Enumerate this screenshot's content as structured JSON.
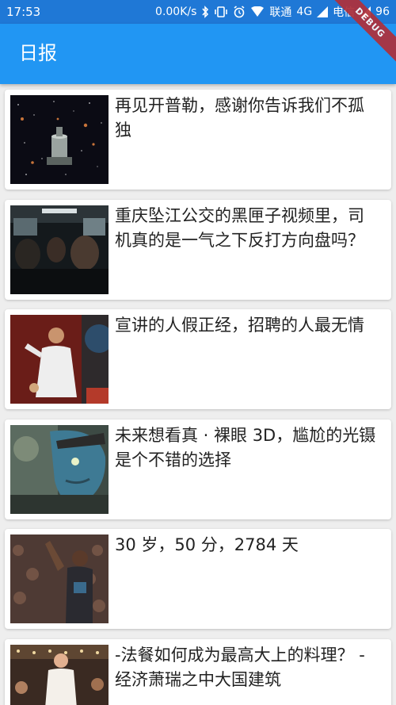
{
  "status_bar": {
    "time": "17:53",
    "network_speed": "0.00K/s",
    "carrier1": "联通",
    "network_type": "4G",
    "carrier2": "电信",
    "battery": "96",
    "icons": [
      "bluetooth-icon",
      "vibrate-icon",
      "alarm-icon",
      "wifi-icon",
      "signal-icon",
      "battery-icon"
    ]
  },
  "app_bar": {
    "title": "日报"
  },
  "debug_banner": {
    "label": "DEBUG"
  },
  "articles": [
    {
      "title": "再见开普勒，感谢你告诉我们不孤独"
    },
    {
      "title": "重庆坠江公交的黑匣子视频里，司机真的是一气之下反打方向盘吗？"
    },
    {
      "title": "宣讲的人假正经，招聘的人最无情"
    },
    {
      "title": "未来想看真 · 裸眼 3D，尴尬的光镊是个不错的选择"
    },
    {
      "title": "30 岁，50 分，2784 天"
    },
    {
      "title": "-法餐如何成为最高大上的料理？ -经济萧瑞之中大国建筑"
    }
  ],
  "colors": {
    "status_bar": "#1f78d6",
    "app_bar": "#2196f3",
    "background": "#eeeeee",
    "card": "#ffffff",
    "debug_banner": "#b0303a"
  }
}
